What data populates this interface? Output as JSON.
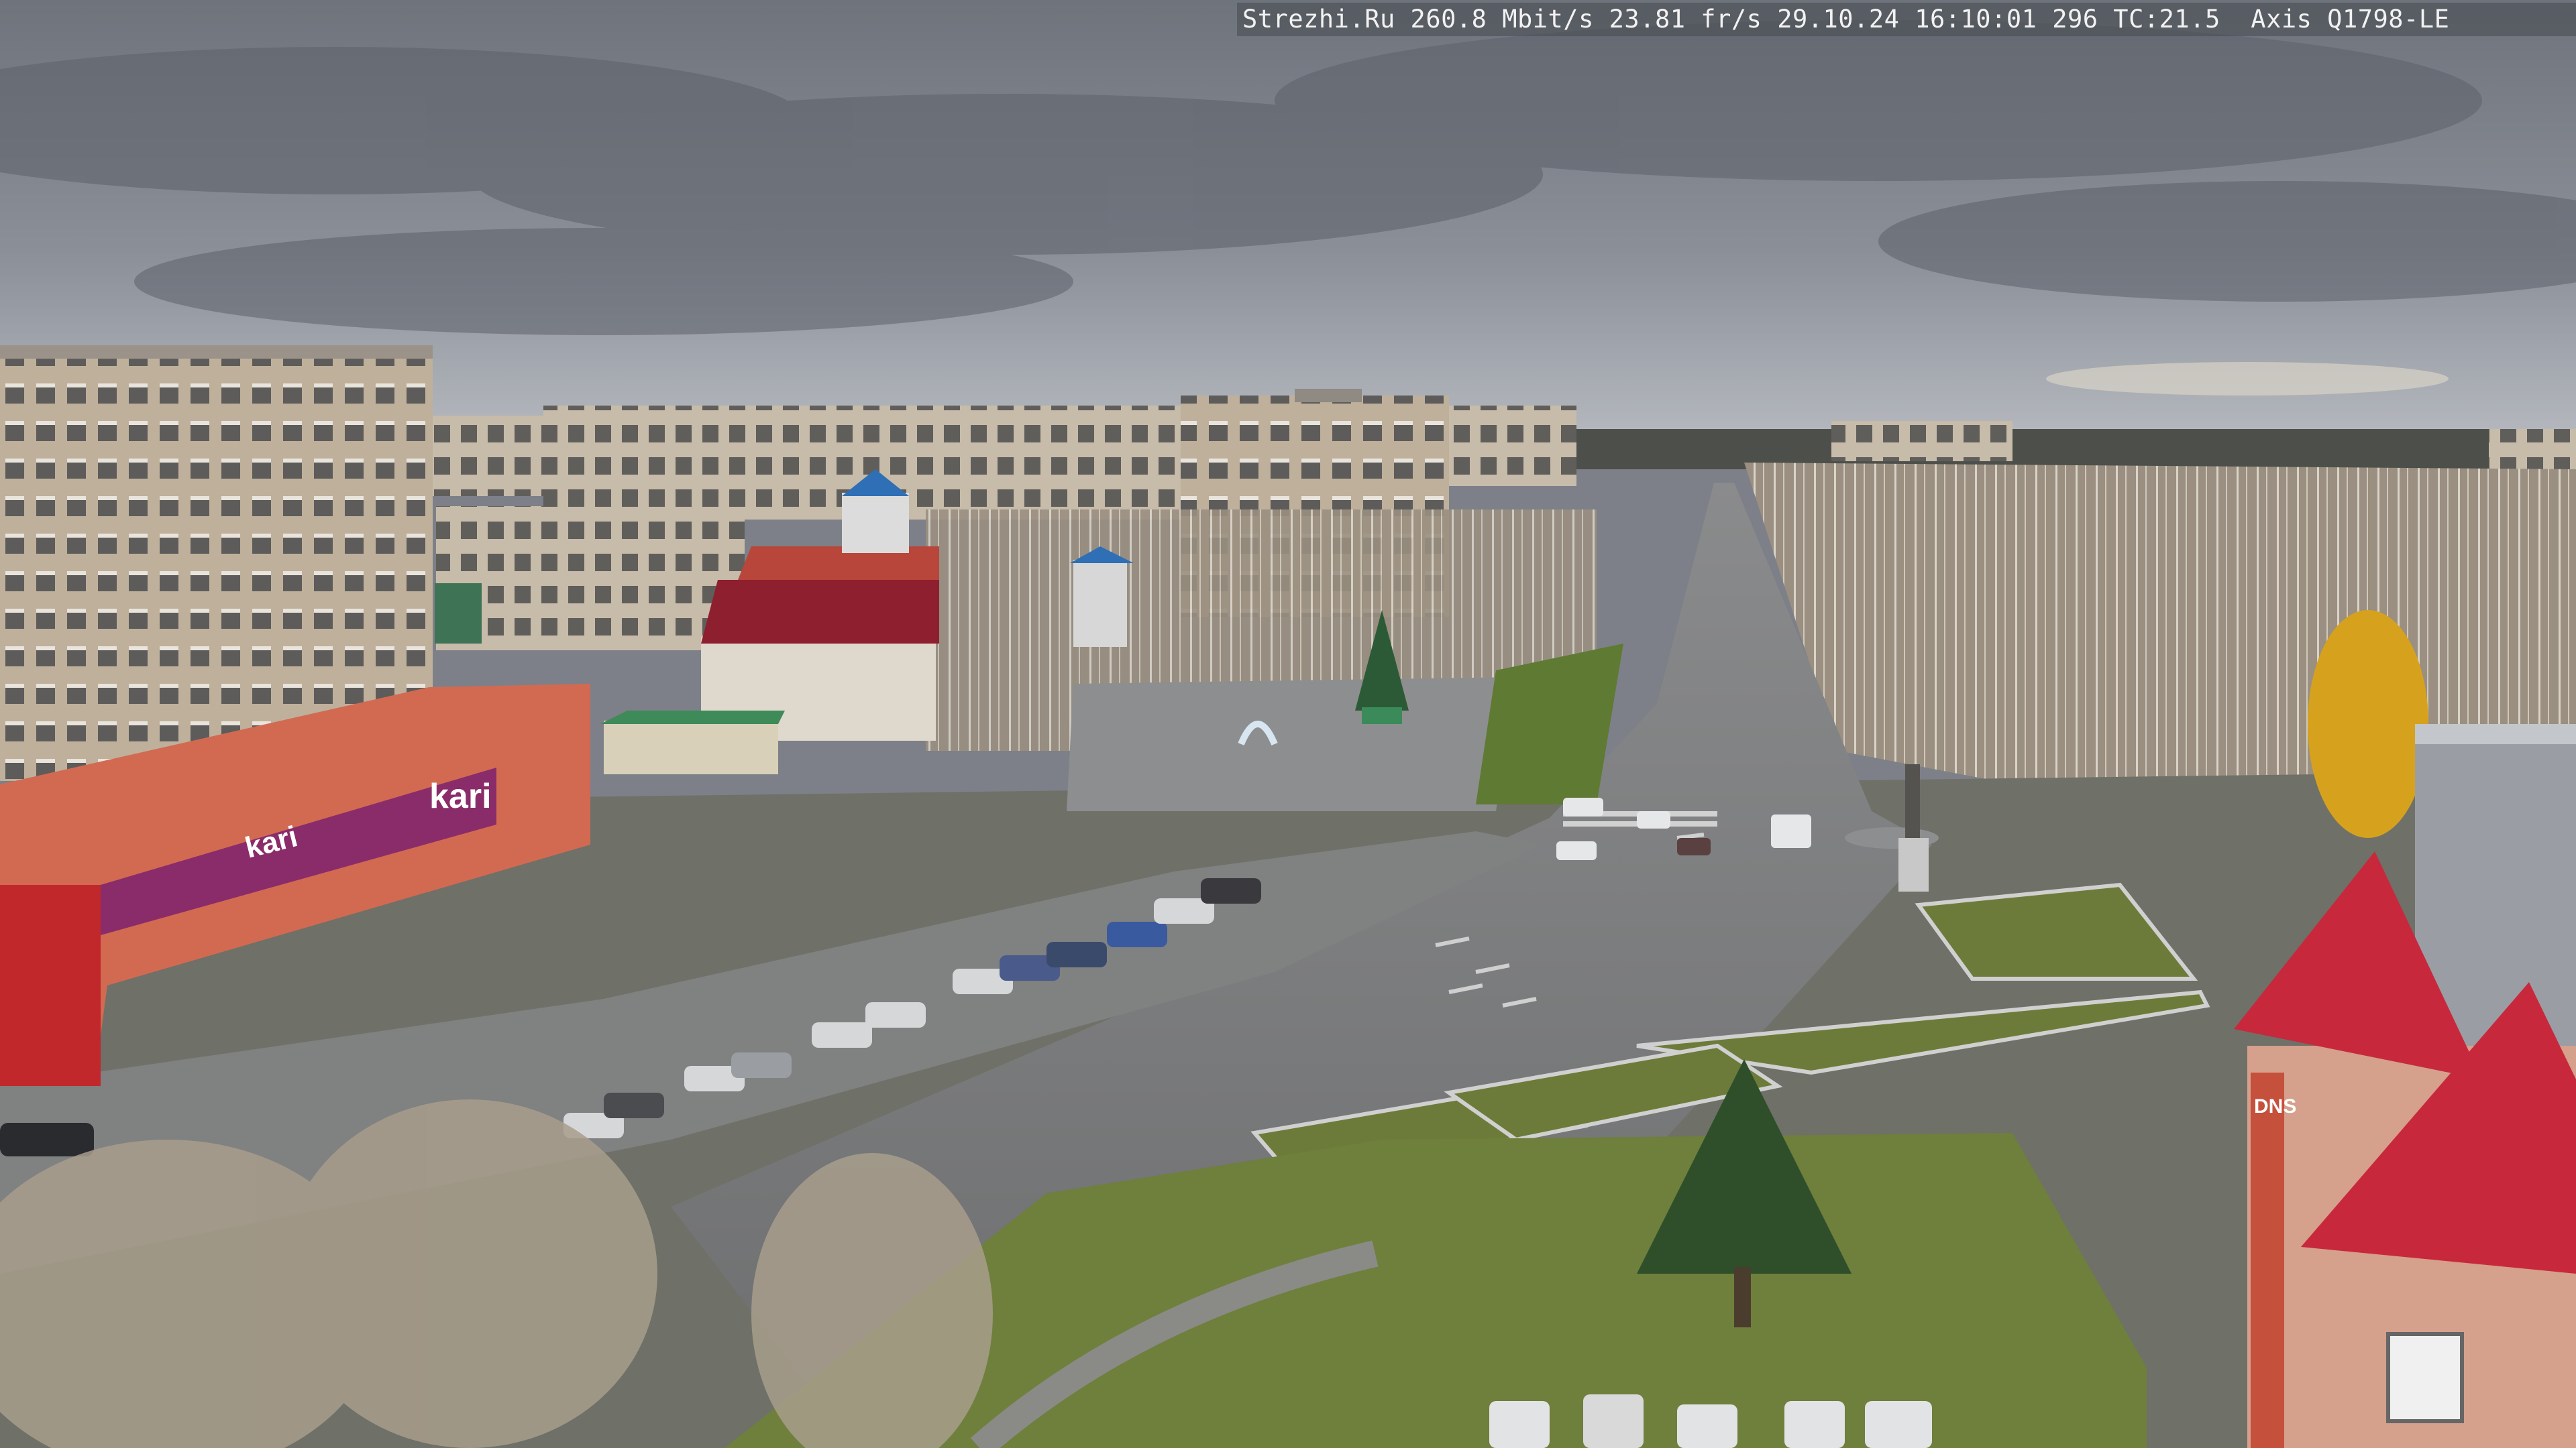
{
  "overlay": {
    "site": "Strezhi.Ru",
    "bitrate": "260.8 Mbit/s",
    "framerate": "23.81 fr/s",
    "date": "29.10.24",
    "time": "16:10:01",
    "frame_count": "296",
    "tc": "TC:21.5",
    "camera_model": "Axis Q1798-LE"
  },
  "signs": {
    "store_brand": "kari",
    "store_banner_brand": "kari",
    "electronics_brand": "DNS"
  },
  "colors": {
    "sky": "#7f848d",
    "sky_light": "#c9ccd2",
    "road": "#7a7b7c",
    "grass": "#6d7b3a",
    "brick_building": "#c2b3a0",
    "kari_facade": "#d26a52",
    "kari_banner": "#8a2c6a",
    "red_roof": "#c8283c",
    "dark_red_roof": "#8e1f2e",
    "blue_tower": "#2f6fb6",
    "birch_trees": "#a89d8c",
    "yellow_tree": "#d6a21e"
  }
}
